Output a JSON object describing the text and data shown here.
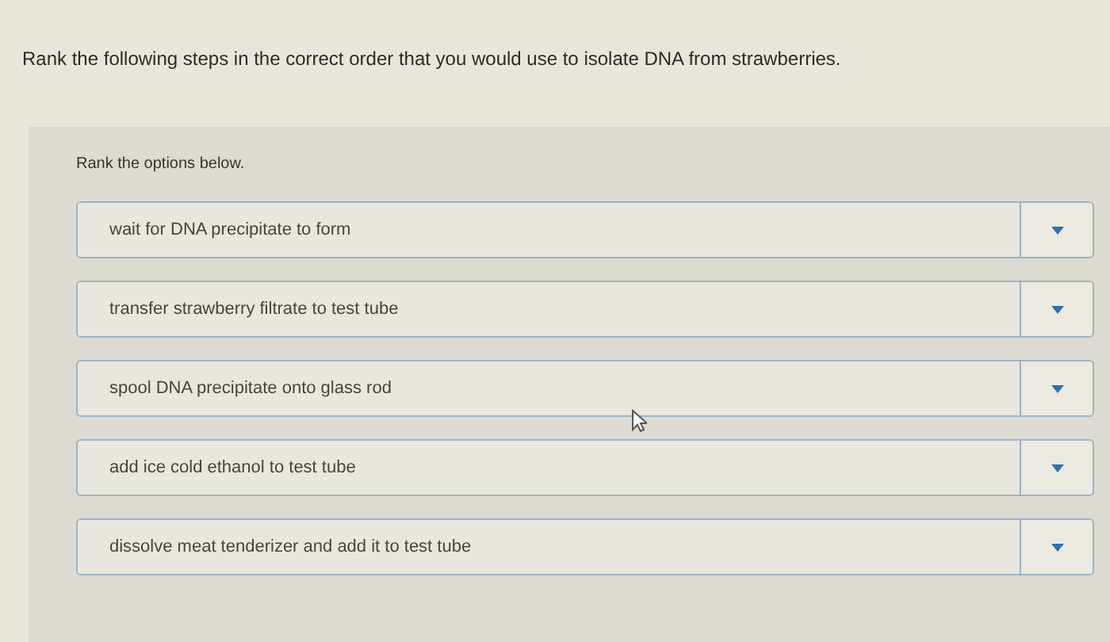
{
  "question": "Rank the following steps in the correct order that you would use to isolate DNA from strawberries.",
  "instruction": "Rank the options below.",
  "options": [
    {
      "text": "wait for DNA precipitate to form"
    },
    {
      "text": "transfer strawberry filtrate to test tube"
    },
    {
      "text": "spool DNA precipitate onto glass rod"
    },
    {
      "text": "add ice cold ethanol to test tube"
    },
    {
      "text": "dissolve meat tenderizer and add it to test tube"
    }
  ]
}
